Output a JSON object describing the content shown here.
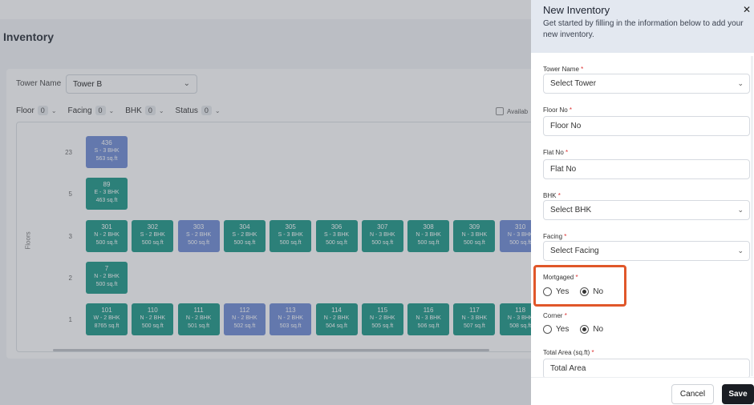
{
  "background": {
    "page_title": "Inventory",
    "tower_label": "Tower Name",
    "tower_value": "Tower B",
    "filters": [
      {
        "label": "Floor",
        "count": "0"
      },
      {
        "label": "Facing",
        "count": "0"
      },
      {
        "label": "BHK",
        "count": "0"
      },
      {
        "label": "Status",
        "count": "0"
      }
    ],
    "available_label": "Availab",
    "axis_label": "Floors",
    "floors": [
      "23",
      "5",
      "3",
      "2",
      "1"
    ],
    "units": {
      "f23": [
        {
          "no": "436",
          "facing": "S - 3 BHK",
          "area": "563 sq.ft",
          "color": "blue"
        }
      ],
      "f5": [
        {
          "no": "89",
          "facing": "E - 3 BHK",
          "area": "463 sq.ft",
          "color": "teal"
        }
      ],
      "f3": [
        {
          "no": "301",
          "facing": "N - 2 BHK",
          "area": "500 sq.ft",
          "color": "teal"
        },
        {
          "no": "302",
          "facing": "S - 2 BHK",
          "area": "500 sq.ft",
          "color": "teal"
        },
        {
          "no": "303",
          "facing": "S - 2 BHK",
          "area": "500 sq.ft",
          "color": "blue"
        },
        {
          "no": "304",
          "facing": "S - 2 BHK",
          "area": "500 sq.ft",
          "color": "teal"
        },
        {
          "no": "305",
          "facing": "S - 3 BHK",
          "area": "500 sq.ft",
          "color": "teal"
        },
        {
          "no": "306",
          "facing": "S - 3 BHK",
          "area": "500 sq.ft",
          "color": "teal"
        },
        {
          "no": "307",
          "facing": "N - 3 BHK",
          "area": "500 sq.ft",
          "color": "teal"
        },
        {
          "no": "308",
          "facing": "N - 3 BHK",
          "area": "500 sq.ft",
          "color": "teal"
        },
        {
          "no": "309",
          "facing": "N - 3 BHK",
          "area": "500 sq.ft",
          "color": "teal"
        },
        {
          "no": "310",
          "facing": "N - 3 BHK",
          "area": "500 sq.ft",
          "color": "blue"
        }
      ],
      "f2": [
        {
          "no": "7",
          "facing": "N - 2 BHK",
          "area": "500 sq.ft",
          "color": "teal"
        }
      ],
      "f1": [
        {
          "no": "101",
          "facing": "W - 2 BHK",
          "area": "8765 sq.ft",
          "color": "teal"
        },
        {
          "no": "110",
          "facing": "N - 2 BHK",
          "area": "500 sq.ft",
          "color": "teal"
        },
        {
          "no": "111",
          "facing": "N - 2 BHK",
          "area": "501 sq.ft",
          "color": "teal"
        },
        {
          "no": "112",
          "facing": "N - 2 BHK",
          "area": "502 sq.ft",
          "color": "blue"
        },
        {
          "no": "113",
          "facing": "N - 2 BHK",
          "area": "503 sq.ft",
          "color": "blue"
        },
        {
          "no": "114",
          "facing": "N - 2 BHK",
          "area": "504 sq.ft",
          "color": "teal"
        },
        {
          "no": "115",
          "facing": "N - 2 BHK",
          "area": "505 sq.ft",
          "color": "teal"
        },
        {
          "no": "116",
          "facing": "N - 3 BHK",
          "area": "506 sq.ft",
          "color": "teal"
        },
        {
          "no": "117",
          "facing": "N - 3 BHK",
          "area": "507 sq.ft",
          "color": "teal"
        },
        {
          "no": "118",
          "facing": "N - 3 BHK",
          "area": "508 sq.ft",
          "color": "teal"
        }
      ]
    }
  },
  "panel": {
    "title": "New Inventory",
    "subtitle": "Get started by filling in the information below to add your new inventory.",
    "close_icon": "close-icon",
    "fields": {
      "tower": {
        "label": "Tower Name",
        "placeholder": "Select Tower"
      },
      "floor": {
        "label": "Floor No",
        "placeholder": "Floor No"
      },
      "flat": {
        "label": "Flat No",
        "placeholder": "Flat No"
      },
      "bhk": {
        "label": "BHK",
        "placeholder": "Select BHK"
      },
      "facing": {
        "label": "Facing",
        "placeholder": "Select Facing"
      },
      "mortgaged": {
        "label": "Mortgaged",
        "options": [
          "Yes",
          "No"
        ],
        "selected": "No"
      },
      "corner": {
        "label": "Corner",
        "options": [
          "Yes",
          "No"
        ],
        "selected": "No"
      },
      "total_area": {
        "label": "Total Area (sq.ft)",
        "placeholder": "Total Area"
      }
    },
    "required_mark": "*",
    "cancel_label": "Cancel",
    "save_label": "Save"
  },
  "colors": {
    "teal_unit": "#2ea090",
    "blue_unit": "#7a95d8",
    "highlight": "#e0572a",
    "save_button": "#1a1d23"
  }
}
